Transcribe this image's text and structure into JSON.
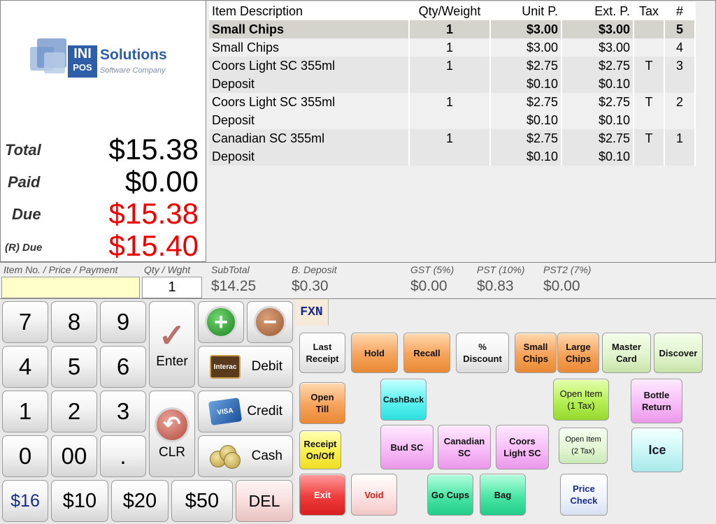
{
  "logo": {
    "ini": "INI",
    "pos": "POS",
    "name": "Solutions",
    "tagline": "Software Company"
  },
  "summary": {
    "total_label": "Total",
    "total_value": "$15.38",
    "paid_label": "Paid",
    "paid_value": "$0.00",
    "due_label": "Due",
    "due_value": "$15.38",
    "rdue_label": "(R) Due",
    "rdue_value": "$15.40",
    "due_color": "#ee0000"
  },
  "table": {
    "headers": {
      "desc": "Item Description",
      "qty": "Qty/Weight",
      "unit": "Unit P.",
      "ext": "Ext. P.",
      "tax": "Tax",
      "num": "#"
    },
    "rows": [
      {
        "desc": "Small Chips",
        "qty": "1",
        "unit": "$3.00",
        "ext": "$3.00",
        "tax": "",
        "num": "5",
        "selected": true,
        "indent": false,
        "alt": false
      },
      {
        "desc": "Small Chips",
        "qty": "1",
        "unit": "$3.00",
        "ext": "$3.00",
        "tax": "",
        "num": "4",
        "selected": false,
        "indent": false,
        "alt": true
      },
      {
        "desc": "Coors Light SC 355ml",
        "qty": "1",
        "unit": "$2.75",
        "ext": "$2.75",
        "tax": "T",
        "num": "3",
        "selected": false,
        "indent": false,
        "alt": false
      },
      {
        "desc": "Deposit",
        "qty": "",
        "unit": "$0.10",
        "ext": "$0.10",
        "tax": "",
        "num": "",
        "selected": false,
        "indent": true,
        "alt": false
      },
      {
        "desc": "Coors Light SC 355ml",
        "qty": "1",
        "unit": "$2.75",
        "ext": "$2.75",
        "tax": "T",
        "num": "2",
        "selected": false,
        "indent": false,
        "alt": true
      },
      {
        "desc": "Deposit",
        "qty": "",
        "unit": "$0.10",
        "ext": "$0.10",
        "tax": "",
        "num": "",
        "selected": false,
        "indent": true,
        "alt": true
      },
      {
        "desc": "Canadian SC 355ml",
        "qty": "1",
        "unit": "$2.75",
        "ext": "$2.75",
        "tax": "T",
        "num": "1",
        "selected": false,
        "indent": false,
        "alt": false
      },
      {
        "desc": "Deposit",
        "qty": "",
        "unit": "$0.10",
        "ext": "$0.10",
        "tax": "",
        "num": "",
        "selected": false,
        "indent": true,
        "alt": false
      }
    ]
  },
  "totals": {
    "item_label": "Item No. / Price / Payment",
    "item_value": "",
    "qty_label": "Qty / Wght",
    "qty_value": "1",
    "subtotal_label": "SubTotal",
    "subtotal_value": "$14.25",
    "deposit_label": "B. Deposit",
    "deposit_value": "$0.30",
    "gst_label": "GST (5%)",
    "gst_value": "$0.00",
    "pst_label": "PST (10%)",
    "pst_value": "$0.83",
    "pst2_label": "PST2 (7%)",
    "pst2_value": "$0.00"
  },
  "keypad": {
    "d7": "7",
    "d8": "8",
    "d9": "9",
    "d4": "4",
    "d5": "5",
    "d6": "6",
    "d1": "1",
    "d2": "2",
    "d3": "3",
    "d0": "0",
    "d00": "00",
    "dot": ".",
    "enter": "Enter",
    "clr": "CLR",
    "debit": "Debit",
    "credit": "Credit",
    "cash": "Cash",
    "c16": "$16",
    "c10": "$10",
    "c20": "$20",
    "c50": "$50",
    "del": "DEL",
    "icons": {
      "plus": "plus-circle-icon",
      "minus": "minus-circle-icon",
      "enter": "checkmark-icon",
      "clr": "undo-arrow-icon",
      "debit": "interac-card-icon",
      "credit": "visa-card-icon",
      "cash": "coins-icon"
    }
  },
  "functions": {
    "tab": "FXN",
    "last_receipt": "Last\nReceipt",
    "hold": "Hold",
    "recall": "Recall",
    "discount": "%\nDiscount",
    "small_chips": "Small\nChips",
    "large_chips": "Large\nChips",
    "master_card": "Master\nCard",
    "discover": "Discover",
    "open_till": "Open\nTill",
    "cashback": "CashBack",
    "open_item_1": "Open Item\n(1 Tax)",
    "bottle_return": "Bottle\nReturn",
    "receipt_onoff": "Receipt\nOn/Off",
    "bud_sc": "Bud SC",
    "canadian_sc": "Canadian\nSC",
    "coors_light_sc": "Coors\nLight SC",
    "open_item_2": "Open Item\n(2 Tax)",
    "ice": "Ice",
    "exit": "Exit",
    "void": "Void",
    "go_cups": "Go Cups",
    "bag": "Bag",
    "price_check": "Price\nCheck"
  }
}
